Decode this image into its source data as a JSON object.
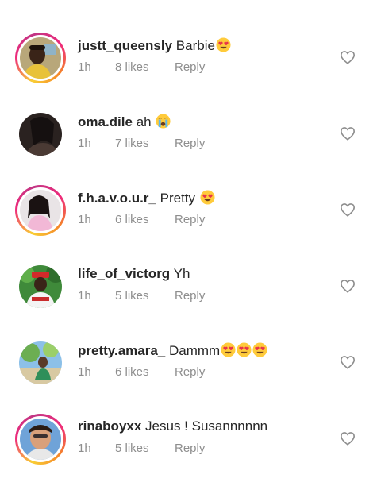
{
  "comments": [
    {
      "username": "justt_queensly",
      "text": "Barbie",
      "emojis": [
        "heart-eyes"
      ],
      "time": "1h",
      "likes": "8 likes",
      "reply": "Reply",
      "story_ring": true
    },
    {
      "username": "oma.dile",
      "text": "ah",
      "emojis": [
        "crying"
      ],
      "time": "1h",
      "likes": "7 likes",
      "reply": "Reply",
      "story_ring": false
    },
    {
      "username": "f.h.a.v.o.u.r_",
      "text": "Pretty",
      "emojis": [
        "heart-eyes"
      ],
      "time": "1h",
      "likes": "6 likes",
      "reply": "Reply",
      "story_ring": true
    },
    {
      "username": "life_of_victorg",
      "text": "Yh",
      "emojis": [],
      "time": "1h",
      "likes": "5 likes",
      "reply": "Reply",
      "story_ring": false
    },
    {
      "username": "pretty.amara_",
      "text": "Dammm",
      "emojis": [
        "heart-eyes",
        "heart-eyes",
        "heart-eyes"
      ],
      "time": "1h",
      "likes": "6 likes",
      "reply": "Reply",
      "story_ring": false
    },
    {
      "username": "rinaboyxx",
      "text": "Jesus ! Susannnnnn",
      "emojis": [],
      "time": "1h",
      "likes": "5 likes",
      "reply": "Reply",
      "story_ring": true
    }
  ],
  "icons": {
    "like": "heart-outline-icon"
  },
  "colors": {
    "text": "#262626",
    "meta": "#8e8e8e",
    "heart_outline": "#8e8e8e"
  }
}
